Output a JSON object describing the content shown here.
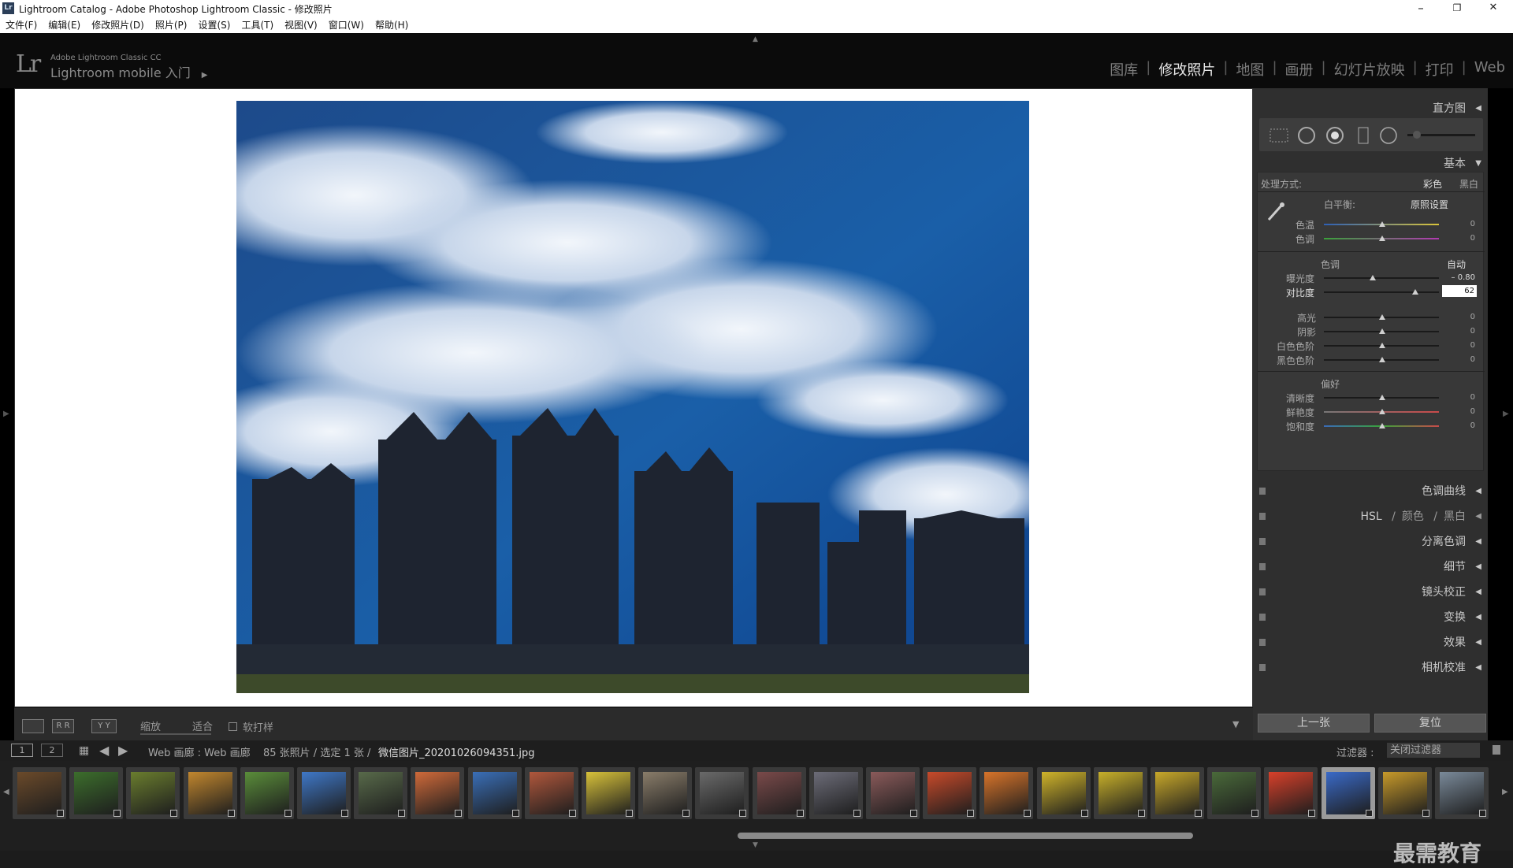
{
  "window": {
    "app_icon": "Lr",
    "title": "Lightroom Catalog - Adobe Photoshop Lightroom Classic - 修改照片",
    "minimize": "–",
    "restore": "❐",
    "close": "✕"
  },
  "menu": [
    "文件(F)",
    "编辑(E)",
    "修改照片(D)",
    "照片(P)",
    "设置(S)",
    "工具(T)",
    "视图(V)",
    "窗口(W)",
    "帮助(H)"
  ],
  "header": {
    "logo": "Lr",
    "product": "Adobe Lightroom Classic CC",
    "mobile": "Lightroom mobile 入门",
    "modules": [
      "图库",
      "修改照片",
      "地图",
      "画册",
      "幻灯片放映",
      "打印",
      "Web"
    ],
    "active_module": "修改照片"
  },
  "toolbar": {
    "view_btn1": "",
    "view_btn2": "R R",
    "view_btn3": "Y Y",
    "zoom_label": "缩放",
    "zoom_value": "适合",
    "softproof": "软打样"
  },
  "panel": {
    "histogram": "直方图",
    "basic": "基本",
    "treatment_label": "处理方式:",
    "treatment_color": "彩色",
    "treatment_bw": "黑白",
    "wb_label": "白平衡:",
    "wb_value": "原照设置",
    "temp": {
      "label": "色温",
      "value": "0"
    },
    "tint": {
      "label": "色调",
      "value": "0"
    },
    "tone_label": "色调",
    "auto": "自动",
    "exposure": {
      "label": "曝光度",
      "value": "– 0.80"
    },
    "contrast": {
      "label": "对比度",
      "value": "62"
    },
    "highlights": {
      "label": "高光",
      "value": "0"
    },
    "shadows": {
      "label": "阴影",
      "value": "0"
    },
    "whites": {
      "label": "白色色阶",
      "value": "0"
    },
    "blacks": {
      "label": "黑色色阶",
      "value": "0"
    },
    "presence": "偏好",
    "clarity": {
      "label": "清晰度",
      "value": "0"
    },
    "vibrance": {
      "label": "鲜艳度",
      "value": "0"
    },
    "saturation": {
      "label": "饱和度",
      "value": "0"
    },
    "tone_curve": "色调曲线",
    "hsl": "HSL",
    "hsl_sep1": "/",
    "hsl_color": "颜色",
    "hsl_sep2": "/",
    "hsl_bw": "黑白",
    "split_toning": "分离色调",
    "detail": "细节",
    "lens": "镜头校正",
    "transform": "变换",
    "effects": "效果",
    "calibration": "相机校准",
    "prev": "上一张",
    "reset": "复位"
  },
  "filmbar": {
    "view1": "1",
    "view2": "2",
    "source": "Web 画廊 : Web 画廊",
    "count": "85 张照片 / 选定 1 张 /",
    "filename": "微信图片_20201026094351.jpg",
    "filter_label": "过滤器 :",
    "filter_value": "关闭过滤器"
  },
  "watermark": "最需教育",
  "colors": {
    "accent": "#e6e6e6",
    "panel": "#2f2f2f",
    "bg": "#000000"
  }
}
